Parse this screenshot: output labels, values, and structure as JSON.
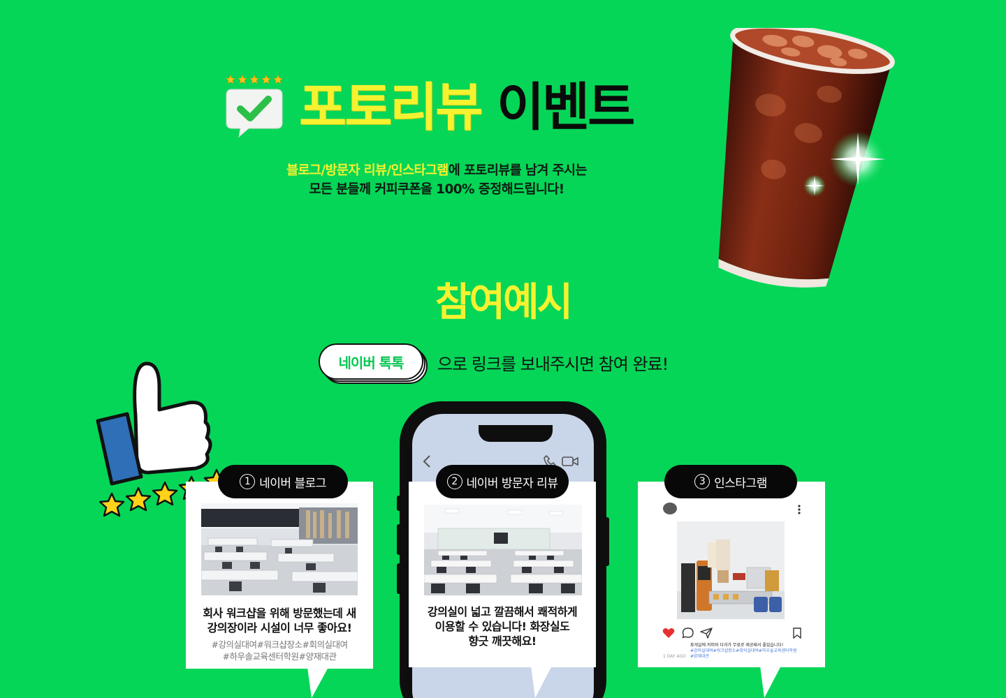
{
  "header": {
    "title_highlight": "포토리뷰",
    "title_rest": "이벤트",
    "subtitle_line1_highlight": "블로그/방문자 리뷰/인스타그램",
    "subtitle_line1_rest": "에 포토리뷰를 남겨 주시는",
    "subtitle_line2_pre": "모든 분들께 ",
    "subtitle_line2_bold": "커피쿠폰을 100%",
    "subtitle_line2_post": " 증정해드립니다!"
  },
  "section": {
    "title": "참여예시",
    "talk_button": "네이버 톡톡",
    "talk_text": "으로 링크를 보내주시면 참여 완료!"
  },
  "cards": [
    {
      "num": "1",
      "label": "네이버 블로그",
      "review_line1": "회사 워크샵을 위해 방문했는데 새",
      "review_line2": "강의장이라 시설이 너무 좋아요!",
      "tags_line1": "#강의실대여#워크샵장소#회의실대여",
      "tags_line2": "#하우솔교육센터학원#양재대관"
    },
    {
      "num": "2",
      "label": "네이버 방문자 리뷰",
      "review_line1": "강의실이 넓고 깔끔해서 쾌적하게",
      "review_line2": "이용할 수 있습니다! 화장실도",
      "review_line3": "향긋 깨끗해요!"
    },
    {
      "num": "3",
      "label": "인스타그램",
      "caption": "휴게실에 커피와 다과가 무료로 제공돼서 좋았습니다!",
      "caption_tags1": "#강의실대여#워크샵장소#회의실대여#하우솔교육센터학원",
      "caption_tags2": "#양재대관",
      "time": "1 DAY AGO"
    }
  ],
  "icons": [
    "check-badge-icon",
    "star-icon",
    "thumbs-up-icon",
    "iced-coffee-icon",
    "back-icon",
    "phone-call-icon",
    "video-call-icon",
    "heart-icon",
    "comment-icon",
    "share-icon",
    "bookmark-icon",
    "more-icon"
  ],
  "colors": {
    "background": "#05d657",
    "highlight": "#f6f230",
    "talk_green": "#05c651"
  }
}
